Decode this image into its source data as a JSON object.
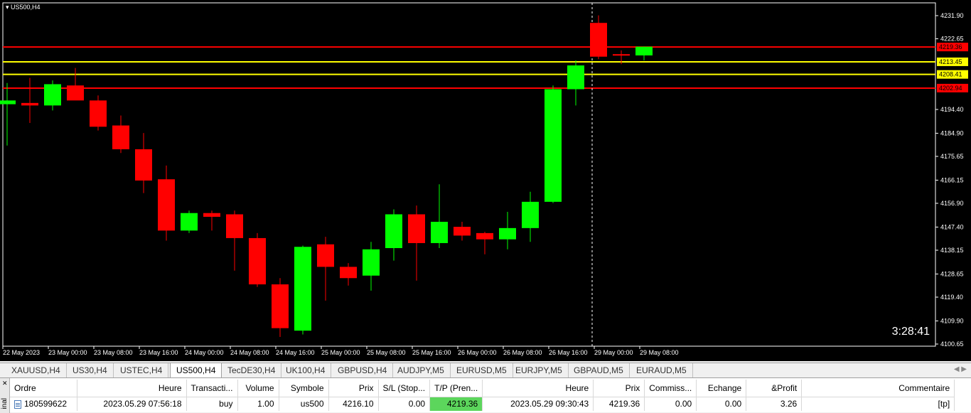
{
  "chart": {
    "symbol_label": "US500,H4",
    "timer": "3:28:41",
    "colors": {
      "bull": "#00ff00",
      "bear": "#ff0000",
      "background": "#000000",
      "support_line": "#ffff00",
      "resistance_line": "#ff0000"
    },
    "price_axis": [
      "4231.90",
      "4222.65",
      "4194.40",
      "4184.90",
      "4175.65",
      "4166.15",
      "4156.90",
      "4147.40",
      "4138.15",
      "4128.65",
      "4119.40",
      "4109.90",
      "4100.65"
    ],
    "time_axis": [
      "22 May 2023",
      "23 May 00:00",
      "23 May 08:00",
      "23 May 16:00",
      "24 May 00:00",
      "24 May 08:00",
      "24 May 16:00",
      "25 May 00:00",
      "25 May 08:00",
      "25 May 16:00",
      "26 May 00:00",
      "26 May 08:00",
      "26 May 16:00",
      "29 May 00:00",
      "29 May 08:00"
    ],
    "levels": [
      {
        "price": 4219.36,
        "label": "4219.36",
        "color": "#ff0000"
      },
      {
        "price": 4213.45,
        "label": "4213.45",
        "color": "#ffff00"
      },
      {
        "price": 4208.41,
        "label": "4208.41",
        "color": "#ffff00"
      },
      {
        "price": 4202.94,
        "label": "4202.94",
        "color": "#ff0000"
      }
    ],
    "candles": [
      {
        "o": 4196.5,
        "h": 4205.0,
        "l": 4180.0,
        "c": 4198.0
      },
      {
        "o": 4197.0,
        "h": 4207.0,
        "l": 4189.0,
        "c": 4196.0
      },
      {
        "o": 4196.0,
        "h": 4206.0,
        "l": 4194.0,
        "c": 4204.5
      },
      {
        "o": 4204.0,
        "h": 4211.0,
        "l": 4199.0,
        "c": 4198.0
      },
      {
        "o": 4198.0,
        "h": 4200.0,
        "l": 4186.0,
        "c": 4187.5
      },
      {
        "o": 4188.0,
        "h": 4192.0,
        "l": 4177.0,
        "c": 4178.5
      },
      {
        "o": 4178.5,
        "h": 4185.0,
        "l": 4161.0,
        "c": 4166.0
      },
      {
        "o": 4166.5,
        "h": 4172.0,
        "l": 4142.0,
        "c": 4146.0
      },
      {
        "o": 4146.0,
        "h": 4154.0,
        "l": 4145.0,
        "c": 4153.0
      },
      {
        "o": 4153.0,
        "h": 4154.0,
        "l": 4146.0,
        "c": 4151.5
      },
      {
        "o": 4152.5,
        "h": 4154.0,
        "l": 4130.0,
        "c": 4143.0
      },
      {
        "o": 4143.0,
        "h": 4145.0,
        "l": 4123.5,
        "c": 4124.5
      },
      {
        "o": 4124.5,
        "h": 4127.0,
        "l": 4103.5,
        "c": 4107.0
      },
      {
        "o": 4106.0,
        "h": 4140.0,
        "l": 4104.5,
        "c": 4139.5
      },
      {
        "o": 4140.5,
        "h": 4143.5,
        "l": 4118.0,
        "c": 4131.5
      },
      {
        "o": 4131.5,
        "h": 4133.0,
        "l": 4124.0,
        "c": 4127.0
      },
      {
        "o": 4128.0,
        "h": 4141.5,
        "l": 4122.0,
        "c": 4138.5
      },
      {
        "o": 4139.0,
        "h": 4154.5,
        "l": 4134.0,
        "c": 4152.5
      },
      {
        "o": 4152.5,
        "h": 4156.0,
        "l": 4126.0,
        "c": 4141.0
      },
      {
        "o": 4141.0,
        "h": 4164.5,
        "l": 4139.0,
        "c": 4149.5
      },
      {
        "o": 4147.5,
        "h": 4149.5,
        "l": 4142.0,
        "c": 4144.0
      },
      {
        "o": 4145.0,
        "h": 4145.5,
        "l": 4136.5,
        "c": 4142.5
      },
      {
        "o": 4142.5,
        "h": 4153.5,
        "l": 4138.5,
        "c": 4147.0
      },
      {
        "o": 4147.0,
        "h": 4161.5,
        "l": 4141.5,
        "c": 4157.5
      },
      {
        "o": 4157.5,
        "h": 4204.0,
        "l": 4157.0,
        "c": 4202.5
      },
      {
        "o": 4202.5,
        "h": 4214.0,
        "l": 4196.0,
        "c": 4212.0
      },
      {
        "o": 4229.0,
        "h": 4232.0,
        "l": 4214.5,
        "c": 4215.5
      },
      {
        "o": 4216.5,
        "h": 4218.0,
        "l": 4212.5,
        "c": 4216.0
      },
      {
        "o": 4216.0,
        "h": 4219.5,
        "l": 4214.0,
        "c": 4219.5
      }
    ],
    "crosshair_time": "29 May 00:00"
  },
  "tabs": [
    "XAUUSD,H4",
    "US30,H4",
    "USTEC,H4",
    "US500,H4",
    "TecDE30,H4",
    "UK100,H4",
    "GBPUSD,H4",
    "AUDJPY,M5",
    "EURUSD,M5",
    "EURJPY,M5",
    "GBPAUD,M5",
    "EURAUD,M5"
  ],
  "active_tab": "US500,H4",
  "terminal": {
    "side_label": "inal",
    "columns": [
      "Ordre",
      "Heure",
      "Transacti...",
      "Volume",
      "Symbole",
      "Prix",
      "S/L (Stop...",
      "T/P (Pren...",
      "Heure",
      "Prix",
      "Commiss...",
      "Echange",
      "&Profit",
      "Commentaire"
    ],
    "row": [
      "180599622",
      "2023.05.29 07:56:18",
      "buy",
      "1.00",
      "us500",
      "4216.10",
      "0.00",
      "4219.36",
      "2023.05.29 09:30:43",
      "4219.36",
      "0.00",
      "0.00",
      "3.26",
      "[tp]"
    ]
  }
}
